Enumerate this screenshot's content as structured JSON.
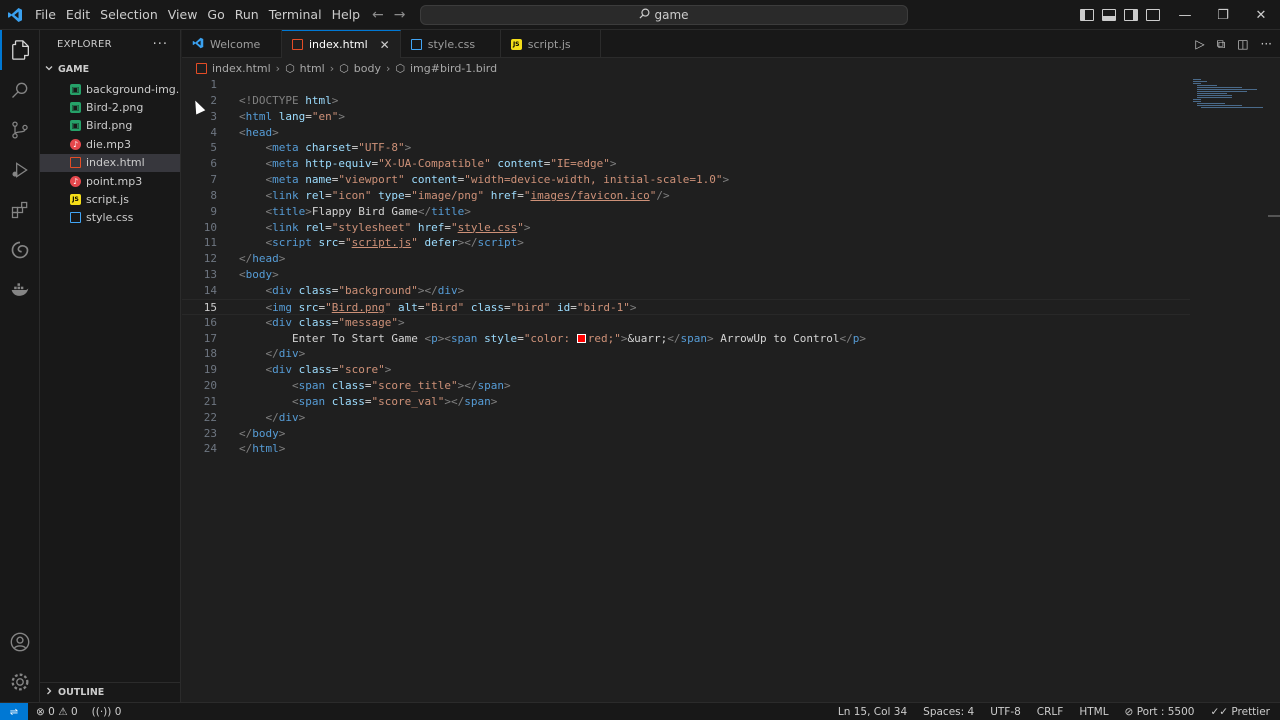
{
  "titlebar": {
    "menu": [
      "File",
      "Edit",
      "Selection",
      "View",
      "Go",
      "Run",
      "Terminal",
      "Help"
    ],
    "search_text": "game"
  },
  "sidebar": {
    "title": "EXPLORER",
    "folder": "GAME",
    "files": [
      {
        "name": "background-img...",
        "type": "img"
      },
      {
        "name": "Bird-2.png",
        "type": "img"
      },
      {
        "name": "Bird.png",
        "type": "img"
      },
      {
        "name": "die.mp3",
        "type": "mp3"
      },
      {
        "name": "index.html",
        "type": "html",
        "selected": true
      },
      {
        "name": "point.mp3",
        "type": "mp3"
      },
      {
        "name": "script.js",
        "type": "js"
      },
      {
        "name": "style.css",
        "type": "css"
      }
    ],
    "outline_label": "OUTLINE"
  },
  "tabs": [
    {
      "label": "Welcome",
      "icon": "vscode-icon"
    },
    {
      "label": "index.html",
      "icon": "html-icon",
      "active": true
    },
    {
      "label": "style.css",
      "icon": "css-icon"
    },
    {
      "label": "script.js",
      "icon": "js-icon"
    }
  ],
  "breadcrumb": [
    "index.html",
    "html",
    "body",
    "img#bird-1.bird"
  ],
  "editor": {
    "current_line": 15,
    "line_numbers": [
      "1",
      "2",
      "3",
      "4",
      "5",
      "6",
      "7",
      "8",
      "9",
      "10",
      "11",
      "12",
      "13",
      "14",
      "15",
      "16",
      "17",
      "18",
      "19",
      "20",
      "21",
      "22",
      "23",
      "24"
    ]
  },
  "statusbar": {
    "errors": "0",
    "warnings": "0",
    "ports": "0",
    "position": "Ln 15, Col 34",
    "spaces": "Spaces: 4",
    "encoding": "UTF-8",
    "eol": "CRLF",
    "language": "HTML",
    "port": "Port : 5500",
    "prettier": "Prettier"
  },
  "colors": {
    "accent": "#0078d4",
    "tag": "#569cd6",
    "attr": "#9cdcfe",
    "string": "#ce9178"
  }
}
